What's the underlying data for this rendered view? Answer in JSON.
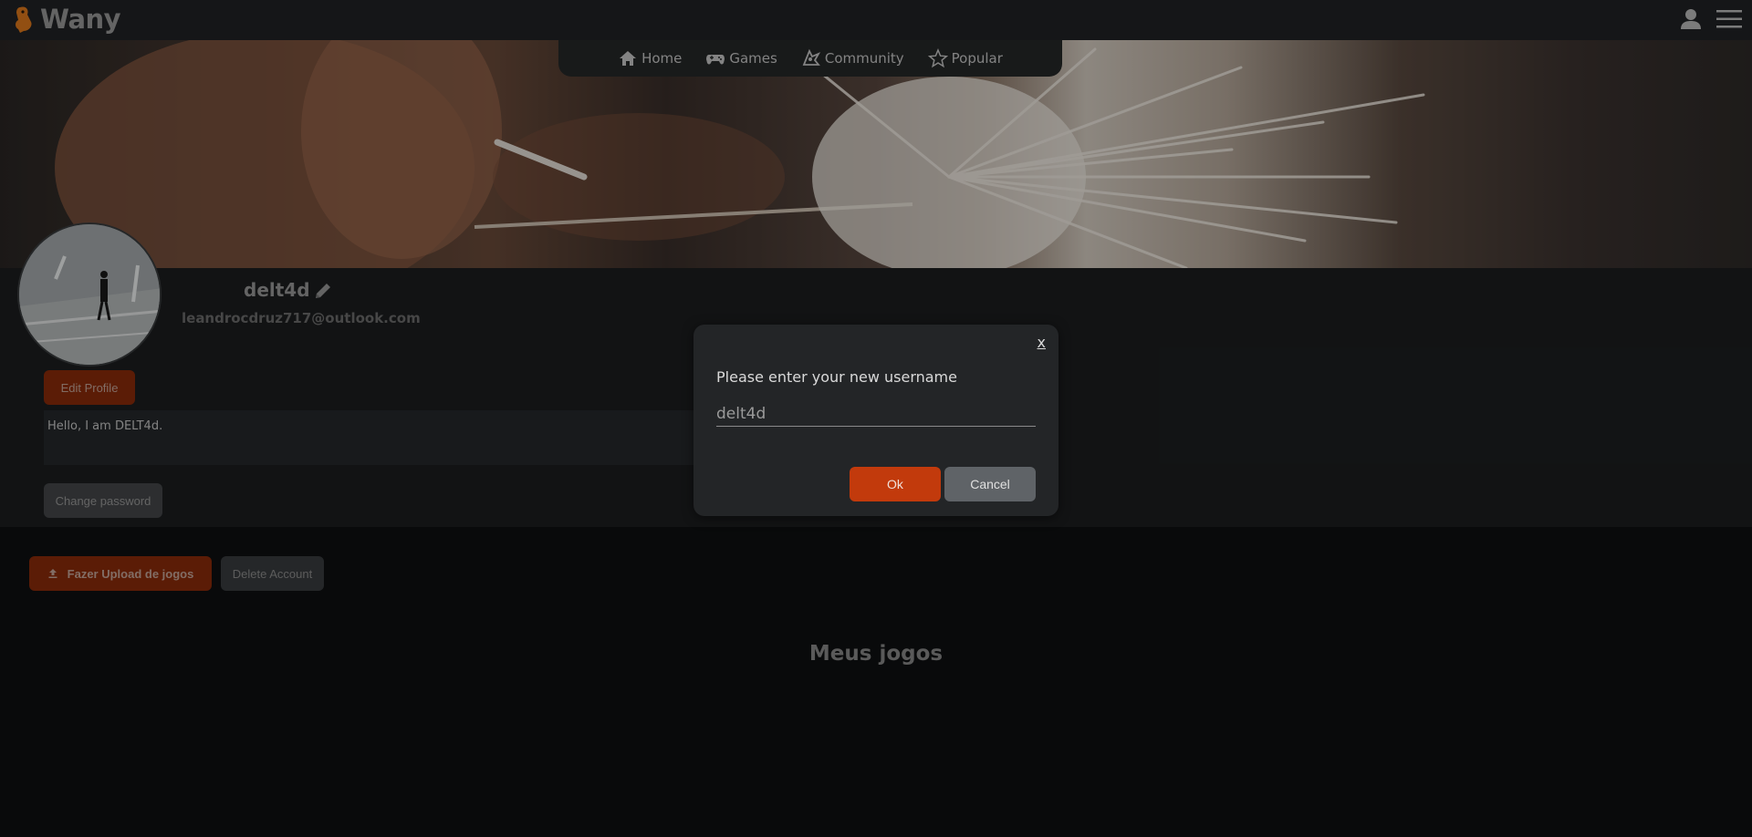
{
  "brand": {
    "name": "Wany"
  },
  "nav": {
    "items": [
      {
        "label": "Home",
        "icon": "home-icon"
      },
      {
        "label": "Games",
        "icon": "gamepad-icon"
      },
      {
        "label": "Community",
        "icon": "community-icon"
      },
      {
        "label": "Popular",
        "icon": "star-icon"
      }
    ]
  },
  "profile": {
    "username": "delt4d",
    "email": "leandrocdruz717@outlook.com",
    "bio": "Hello, I am DELT4d.",
    "edit_label": "Edit Profile",
    "change_password_label": "Change password"
  },
  "actions": {
    "upload_label": "Fazer Upload de jogos",
    "delete_label": "Delete Account"
  },
  "games_section": {
    "title": "Meus jogos"
  },
  "modal": {
    "close_label": "x",
    "prompt": "Please enter your new username",
    "input_value": "delt4d",
    "ok_label": "Ok",
    "cancel_label": "Cancel"
  },
  "colors": {
    "accent": "#c23a0c",
    "accent_dark": "#8c2c0a",
    "background": "#0e1011",
    "panel": "#1c1e20"
  }
}
